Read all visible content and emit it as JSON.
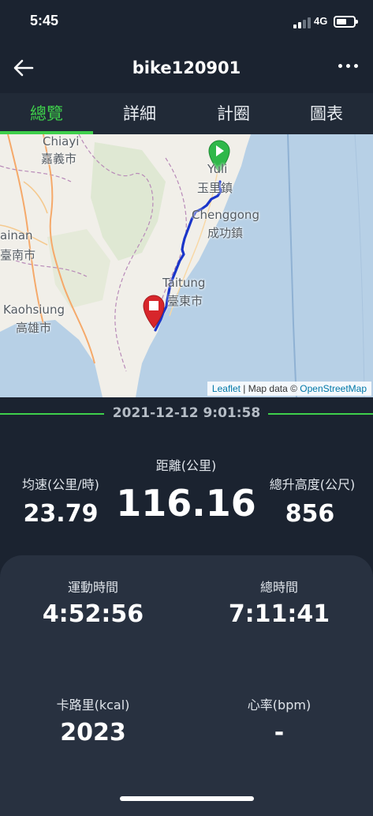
{
  "status_bar": {
    "time": "5:45",
    "network": "4G"
  },
  "header": {
    "title": "bike120901"
  },
  "tabs": [
    {
      "label": "總覽",
      "active": true
    },
    {
      "label": "詳細",
      "active": false
    },
    {
      "label": "計圈",
      "active": false
    },
    {
      "label": "圖表",
      "active": false
    }
  ],
  "map": {
    "labels": {
      "chiayi_en": "Chiayi",
      "chiayi_zh": "嘉義市",
      "yuli_en": "Yuli",
      "yuli_zh": "玉里鎮",
      "chenggong_en": "Chenggong",
      "chenggong_zh": "成功鎮",
      "tainan_en": "ainan",
      "tainan_zh": "臺南市",
      "taitung_en": "Taitung",
      "taitung_zh": "臺東市",
      "kaohsiung_en": "Kaohsiung",
      "kaohsiung_zh": "高雄市"
    },
    "attribution": {
      "leaflet": "Leaflet",
      "separator": " | Map data © ",
      "osm": "OpenStreetMap"
    },
    "route_color": "#1a35c9",
    "start_marker_color": "#2fb84a",
    "end_marker_color": "#d7262b"
  },
  "activity": {
    "datetime": "2021-12-12 9:01:58"
  },
  "stats": {
    "avg_speed": {
      "label": "均速(公里/時)",
      "value": "23.79"
    },
    "distance": {
      "label": "距離(公里)",
      "value": "116.16"
    },
    "elevation": {
      "label": "總升高度(公尺)",
      "value": "856"
    },
    "moving_time": {
      "label": "運動時間",
      "value": "4:52:56"
    },
    "total_time": {
      "label": "總時間",
      "value": "7:11:41"
    },
    "calories": {
      "label": "卡路里(kcal)",
      "value": "2023"
    },
    "heart_rate": {
      "label": "心率(bpm)",
      "value": "-"
    }
  },
  "colors": {
    "accent": "#3ecf4b",
    "background": "#1b2330",
    "panel": "#283140"
  }
}
